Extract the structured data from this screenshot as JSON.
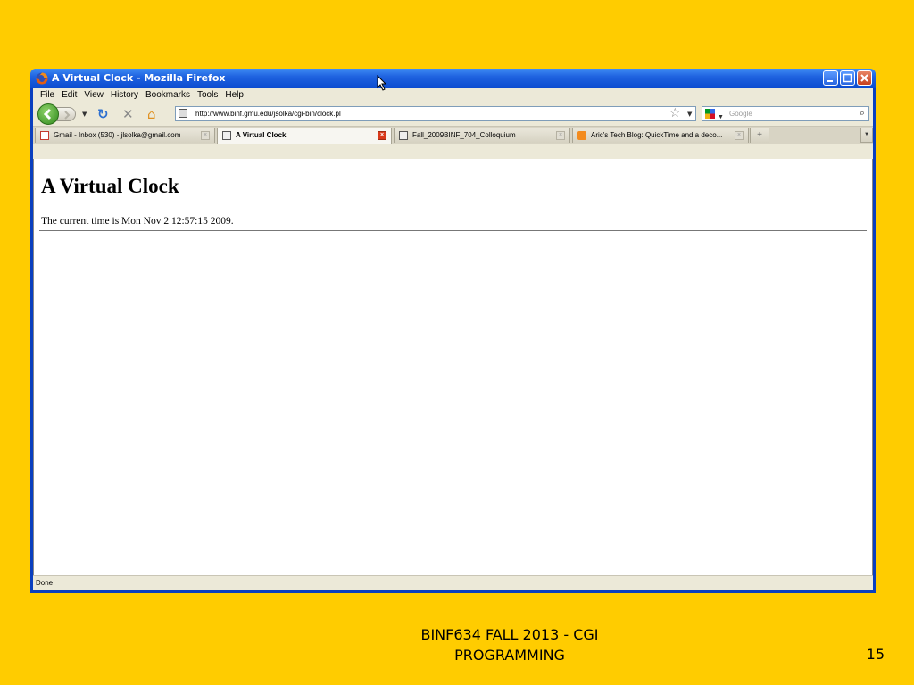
{
  "window": {
    "title": "A Virtual Clock - Mozilla Firefox"
  },
  "menu": [
    "File",
    "Edit",
    "View",
    "History",
    "Bookmarks",
    "Tools",
    "Help"
  ],
  "navbar": {
    "url": "http://www.binf.gmu.edu/jsolka/cgi-bin/clock.pl",
    "search_placeholder": "Google"
  },
  "tabs": [
    {
      "label": "Gmail - Inbox (530) - jlsolka@gmail.com",
      "icon": "gmail-icon",
      "active": false
    },
    {
      "label": "A Virtual Clock",
      "icon": "page-icon",
      "active": true
    },
    {
      "label": "Fall_2009BINF_704_Colloquium",
      "icon": "page-icon",
      "active": false
    },
    {
      "label": "Aric's Tech Blog: QuickTime and a deco...",
      "icon": "blogger-icon",
      "active": false
    }
  ],
  "page": {
    "heading": "A Virtual Clock",
    "text": "The current time is Mon Nov 2 12:57:15 2009."
  },
  "status": "Done",
  "slide": {
    "footer_line1": "BINF634 FALL 2013 - CGI",
    "footer_line2": "PROGRAMMING",
    "number": "15"
  },
  "colors": {
    "slide_background": "#FFCC00",
    "titlebar": "#0B4BD0"
  }
}
